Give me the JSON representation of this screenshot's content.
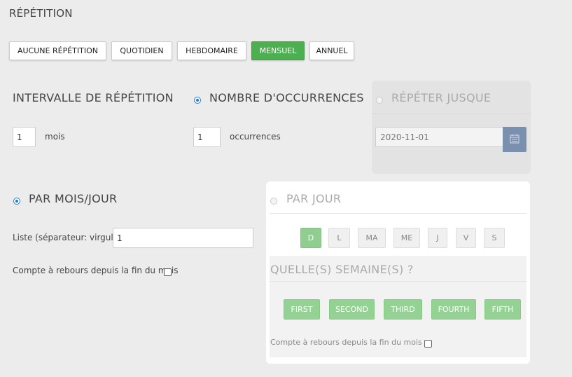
{
  "title": "RÉPÉTITION",
  "tabs": [
    {
      "label": "AUCUNE RÉPÉTITION",
      "active": false
    },
    {
      "label": "QUOTIDIEN",
      "active": false
    },
    {
      "label": "HEBDOMAIRE",
      "active": false
    },
    {
      "label": "MENSUEL",
      "active": true
    },
    {
      "label": "ANNUEL",
      "active": false
    }
  ],
  "interval": {
    "label": "INTERVALLE DE RÉPÉTITION",
    "value": "1",
    "unit": "mois"
  },
  "occurrences": {
    "label": "NOMBRE D'OCCURRENCES",
    "selected": true,
    "value": "1",
    "unit": "occurrences"
  },
  "repeat_until": {
    "label": "RÉPÉTER JUSQUE",
    "selected": false,
    "date": "2020-11-01",
    "calendar_icon": "calendar-icon"
  },
  "by_month_day": {
    "label": "PAR MOIS/JOUR",
    "selected": true,
    "list_label": "Liste (séparateur: virgule)",
    "list_value": "1",
    "countdown_label": "Compte à rebours depuis la fin du mois"
  },
  "by_day": {
    "label": "PAR JOUR",
    "selected": false,
    "days": [
      {
        "label": "D",
        "active": true
      },
      {
        "label": "L",
        "active": false
      },
      {
        "label": "MA",
        "active": false
      },
      {
        "label": "ME",
        "active": false
      },
      {
        "label": "J",
        "active": false
      },
      {
        "label": "V",
        "active": false
      },
      {
        "label": "S",
        "active": false
      }
    ],
    "weeks_label": "QUELLE(S) SEMAINE(S) ?",
    "weeks": [
      "FIRST",
      "SECOND",
      "THIRD",
      "FOURTH",
      "FIFTH"
    ],
    "countdown_label": "Compte à rebours depuis la fin du mois"
  },
  "colors": {
    "accent_green": "#4caf50",
    "radio_blue": "#1e7bd6",
    "calendar_button": "#7b8fae"
  }
}
